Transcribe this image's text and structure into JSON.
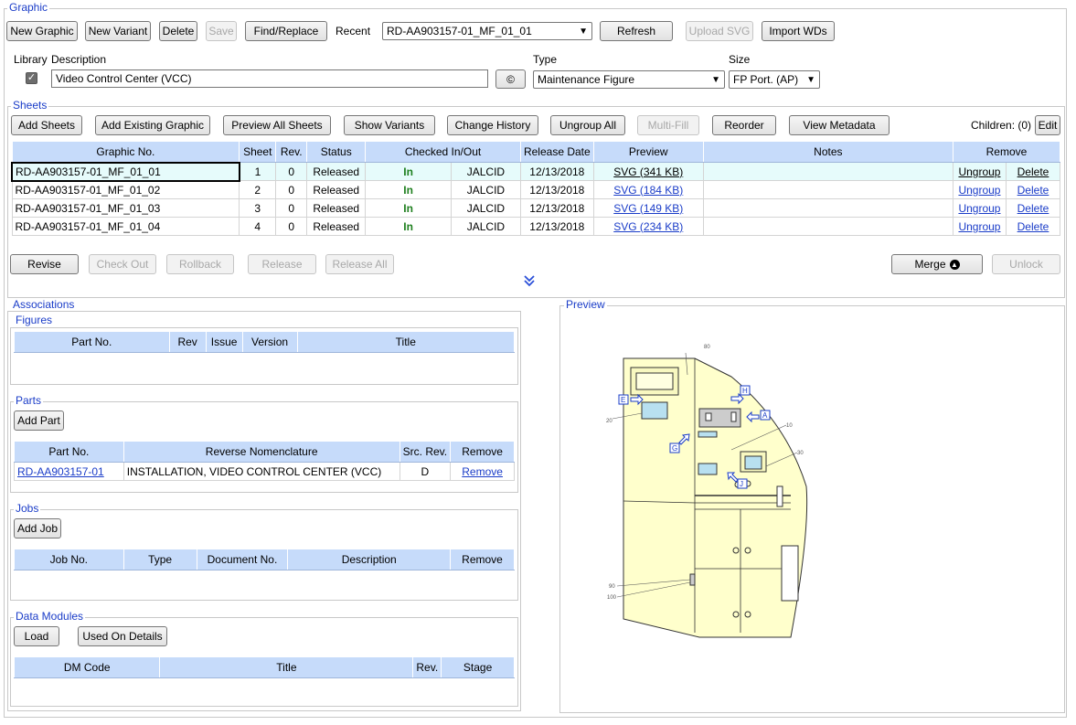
{
  "graphic": {
    "legend": "Graphic",
    "buttons": {
      "new_graphic": "New Graphic",
      "new_variant": "New Variant",
      "delete": "Delete",
      "save": "Save",
      "find_replace": "Find/Replace",
      "refresh": "Refresh",
      "upload_svg": "Upload SVG",
      "import_wds": "Import WDs"
    },
    "recent_label": "Recent",
    "recent_value": "RD-AA903157-01_MF_01_01",
    "library_label": "Library",
    "description_label": "Description",
    "description_value": "Video Control Center (VCC)",
    "copyright_symbol": "©",
    "type_label": "Type",
    "type_value": "Maintenance Figure",
    "size_label": "Size",
    "size_value": "FP Port. (AP)"
  },
  "sheets": {
    "legend": "Sheets",
    "buttons": {
      "add_sheets": "Add Sheets",
      "add_existing": "Add Existing Graphic",
      "preview_all": "Preview All Sheets",
      "show_variants": "Show Variants",
      "change_history": "Change History",
      "ungroup_all": "Ungroup All",
      "multi_fill": "Multi-Fill",
      "reorder": "Reorder",
      "view_metadata": "View Metadata",
      "edit": "Edit",
      "revise": "Revise",
      "check_out": "Check Out",
      "rollback": "Rollback",
      "release": "Release",
      "release_all": "Release All",
      "merge": "Merge",
      "unlock": "Unlock"
    },
    "children_label": "Children: (0)",
    "columns": [
      "Graphic No.",
      "Sheet",
      "Rev.",
      "Status",
      "Checked In/Out",
      "Release Date",
      "Preview",
      "Notes",
      "Remove"
    ],
    "rows": [
      {
        "graphic_no": "RD-AA903157-01_MF_01_01",
        "sheet": "1",
        "rev": "0",
        "status": "Released",
        "checked": "In",
        "user": "JALCID",
        "date": "12/13/2018",
        "preview": "SVG (341 KB)",
        "notes": "",
        "ungroup": "Ungroup",
        "delete": "Delete"
      },
      {
        "graphic_no": "RD-AA903157-01_MF_01_02",
        "sheet": "2",
        "rev": "0",
        "status": "Released",
        "checked": "In",
        "user": "JALCID",
        "date": "12/13/2018",
        "preview": "SVG (184 KB)",
        "notes": "",
        "ungroup": "Ungroup",
        "delete": "Delete"
      },
      {
        "graphic_no": "RD-AA903157-01_MF_01_03",
        "sheet": "3",
        "rev": "0",
        "status": "Released",
        "checked": "In",
        "user": "JALCID",
        "date": "12/13/2018",
        "preview": "SVG (149 KB)",
        "notes": "",
        "ungroup": "Ungroup",
        "delete": "Delete"
      },
      {
        "graphic_no": "RD-AA903157-01_MF_01_04",
        "sheet": "4",
        "rev": "0",
        "status": "Released",
        "checked": "In",
        "user": "JALCID",
        "date": "12/13/2018",
        "preview": "SVG (234 KB)",
        "notes": "",
        "ungroup": "Ungroup",
        "delete": "Delete"
      }
    ]
  },
  "associations": {
    "legend": "Associations",
    "figures": {
      "legend": "Figures",
      "columns": [
        "Part No.",
        "Rev",
        "Issue",
        "Version",
        "Title"
      ]
    },
    "parts": {
      "legend": "Parts",
      "add_button": "Add Part",
      "columns": [
        "Part No.",
        "Reverse Nomenclature",
        "Src. Rev.",
        "Remove"
      ],
      "rows": [
        {
          "part_no": "RD-AA903157-01",
          "nomenclature": "INSTALLATION, VIDEO CONTROL CENTER (VCC)",
          "src_rev": "D",
          "remove": "Remove"
        }
      ]
    },
    "jobs": {
      "legend": "Jobs",
      "add_button": "Add Job",
      "columns": [
        "Job No.",
        "Type",
        "Document No.",
        "Description",
        "Remove"
      ]
    },
    "data_modules": {
      "legend": "Data Modules",
      "load_button": "Load",
      "used_on_button": "Used On Details",
      "columns": [
        "DM Code",
        "Title",
        "Rev.",
        "Stage"
      ]
    }
  },
  "preview": {
    "legend": "Preview",
    "callouts": [
      "80",
      "20",
      "10",
      "30",
      "90",
      "100"
    ],
    "letters": [
      "E",
      "H",
      "A",
      "G",
      "J"
    ]
  }
}
